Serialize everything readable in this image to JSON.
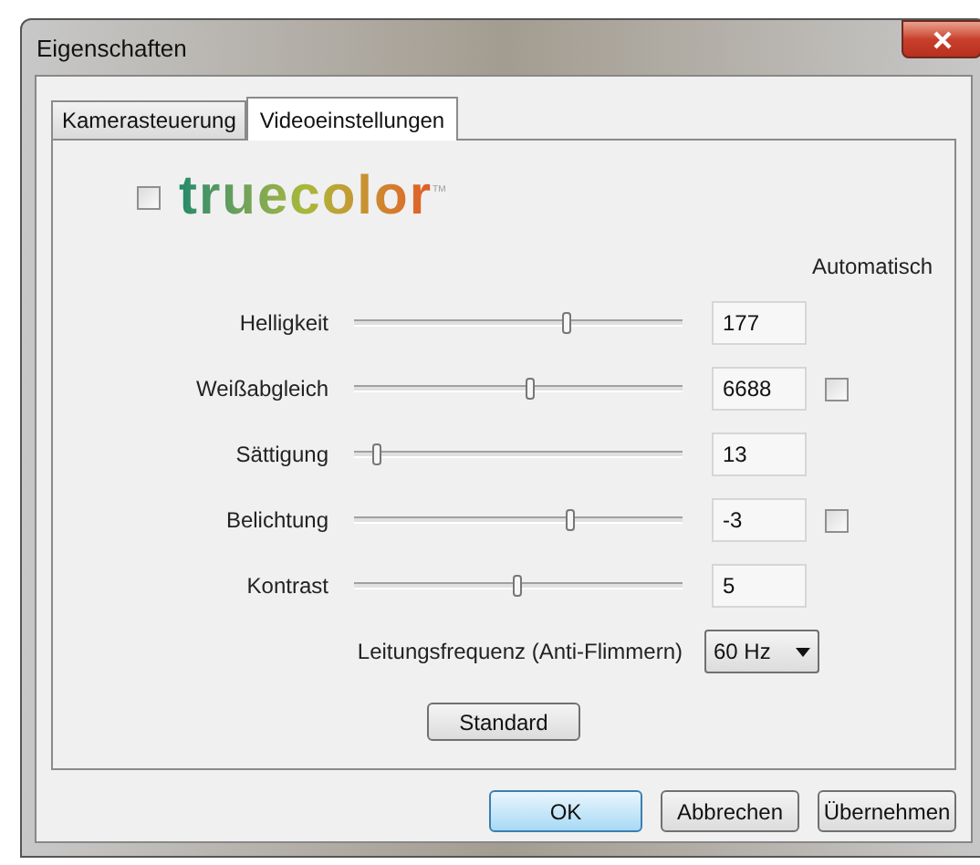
{
  "window": {
    "title": "Eigenschaften"
  },
  "tabs": [
    {
      "label": "Kamerasteuerung",
      "selected": false
    },
    {
      "label": "Videoeinstellungen",
      "selected": true
    }
  ],
  "truecolor": {
    "checked": false,
    "logo": "truecolor",
    "trademark": "TM"
  },
  "auto_header": "Automatisch",
  "rows": [
    {
      "label": "Helligkeit",
      "level": 0.65,
      "value": "177"
    },
    {
      "label": "Weißabgleich",
      "level": 0.54,
      "value": "6688",
      "auto": {
        "checked": false
      }
    },
    {
      "label": "Sättigung",
      "level": 0.07,
      "value": "13"
    },
    {
      "label": "Belichtung",
      "level": 0.66,
      "value": "-3",
      "auto": {
        "checked": false
      }
    },
    {
      "label": "Kontrast",
      "level": 0.5,
      "value": "5"
    }
  ],
  "power_line": {
    "label": "Leitungsfrequenz (Anti-Flimmern)",
    "value": "60 Hz"
  },
  "standard_button": "Standard",
  "buttons": [
    {
      "label": "OK",
      "default": true
    },
    {
      "label": "Abbrechen",
      "default": false
    },
    {
      "label": "Übernehmen",
      "default": false
    }
  ]
}
